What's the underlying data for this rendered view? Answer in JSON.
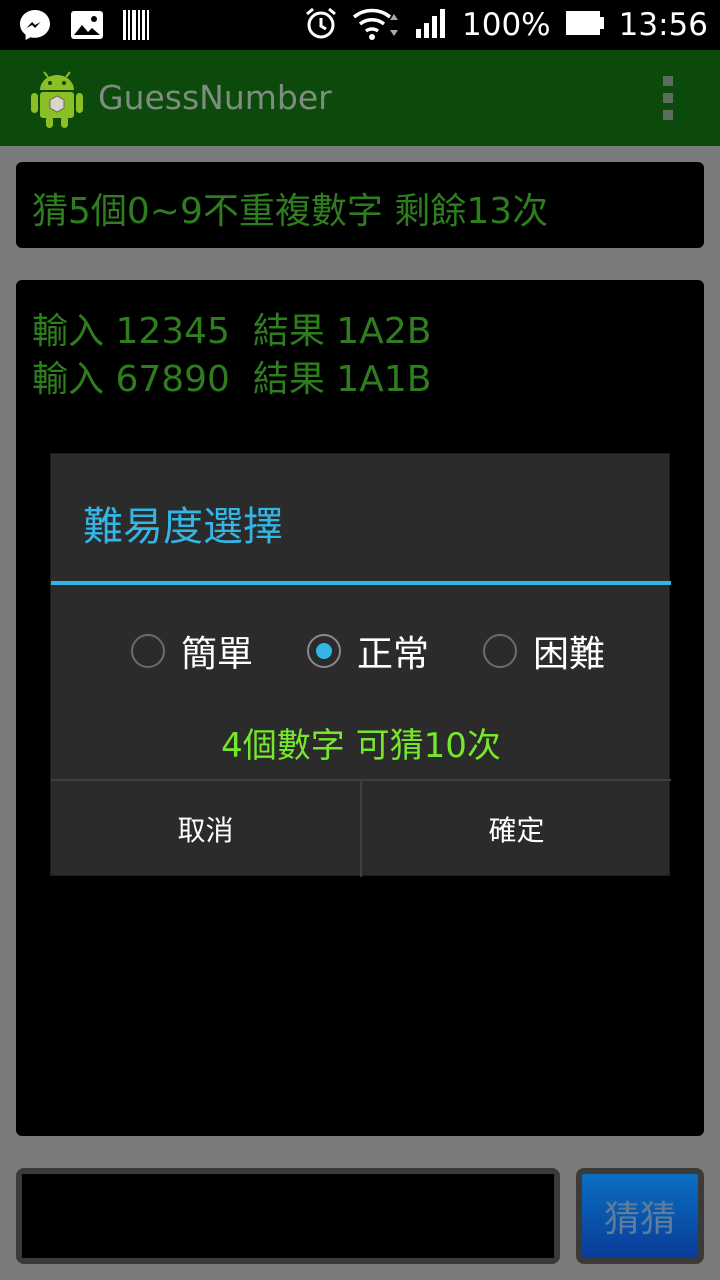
{
  "status_bar": {
    "left_icons": [
      "messenger-icon",
      "gallery-icon",
      "barcode-icon"
    ],
    "right_icons": [
      "alarm-icon",
      "wifi-icon",
      "signal-icon"
    ],
    "battery": "100%",
    "time": "13:56"
  },
  "app_bar": {
    "title": "GuessNumber",
    "logo": "android-logo-icon",
    "menu": "overflow-menu-icon"
  },
  "main": {
    "info": "猜5個0~9不重複數字 剩餘13次",
    "history": [
      "輸入 12345  結果 1A2B",
      "輸入 67890  結果 1A1B"
    ],
    "input_value": "",
    "guess_button": "猜猜"
  },
  "dialog": {
    "title": "難易度選擇",
    "options": [
      {
        "label": "簡單",
        "checked": false
      },
      {
        "label": "正常",
        "checked": true
      },
      {
        "label": "困難",
        "checked": false
      }
    ],
    "info": "4個數字 可猜10次",
    "cancel": "取消",
    "confirm": "確定"
  },
  "colors": {
    "app_bar_bg": "#0b4a0b",
    "accent": "#33b5e5",
    "info_green": "#76e82b",
    "text_green": "#2e7d1e"
  }
}
